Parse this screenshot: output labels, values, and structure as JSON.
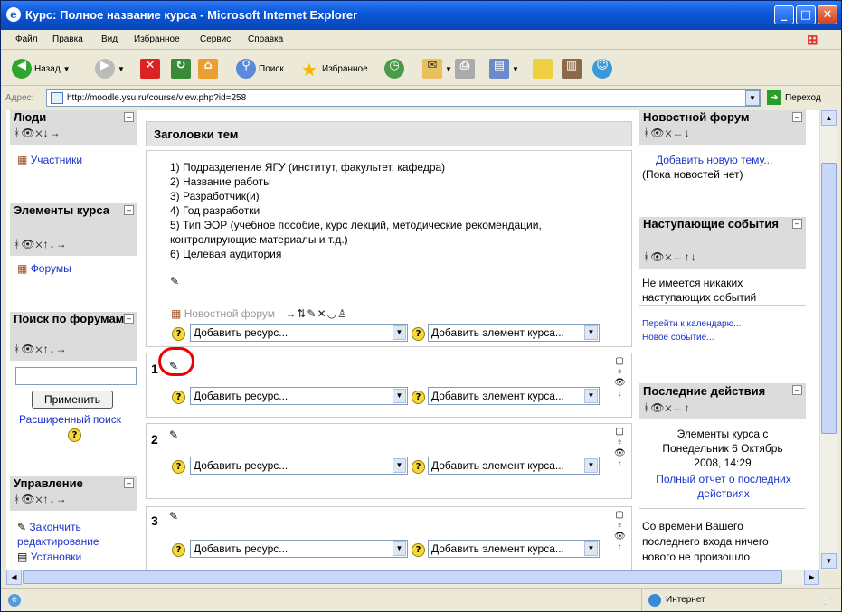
{
  "window": {
    "title": "Курс: Полное название курса - Microsoft Internet Explorer"
  },
  "menu": [
    "Файл",
    "Правка",
    "Вид",
    "Избранное",
    "Сервис",
    "Справка"
  ],
  "toolbar": {
    "back": "Назад",
    "search": "Поиск",
    "favorites": "Избранное"
  },
  "address": {
    "label": "Адрес:",
    "url": "http://moodle.ysu.ru/course/view.php?id=258",
    "go": "Переход"
  },
  "left": {
    "people": {
      "title": "Люди",
      "participants": "Участники"
    },
    "elements": {
      "title": "Элементы курса",
      "forums": "Форумы"
    },
    "search": {
      "title": "Поиск по форумам",
      "apply": "Применить",
      "advanced": "Расширенный поиск"
    },
    "admin": {
      "title": "Управление",
      "finish_edit": "Закончить редактирование",
      "settings": "Установки"
    }
  },
  "center": {
    "header": "Заголовки тем",
    "lines": [
      "1) Подразделение ЯГУ (институт, факультет, кафедра)",
      "2) Название работы",
      "3) Разработчик(и)",
      "4) Год разработки",
      "5) Тип ЭОР (учебное пособие, курс лекций, методические рекомендации,",
      "контролирующие материалы и т.д.)",
      "6) Целевая аудитория"
    ],
    "news_forum": "Новостной форум",
    "add_resource": "Добавить ресурс...",
    "add_element": "Добавить элемент курса...",
    "sections": [
      "1",
      "2",
      "3"
    ]
  },
  "right": {
    "news": {
      "title": "Новостной форум",
      "add_topic": "Добавить новую тему...",
      "no_news": "(Пока новостей нет)"
    },
    "events": {
      "title": "Наступающие события",
      "none": "Не имеется никаких наступающих событий",
      "calendar": "Перейти к календарю...",
      "new_event": "Новое событие..."
    },
    "recent": {
      "title": "Последние действия",
      "since": "Элементы курса с Понедельник 6 Октябрь 2008, 14:29",
      "full_report": "Полный отчет о последних действиях",
      "nothing": "Со времени Вашего последнего входа ничего нового не произошло"
    }
  },
  "status": {
    "zone": "Интернет"
  }
}
